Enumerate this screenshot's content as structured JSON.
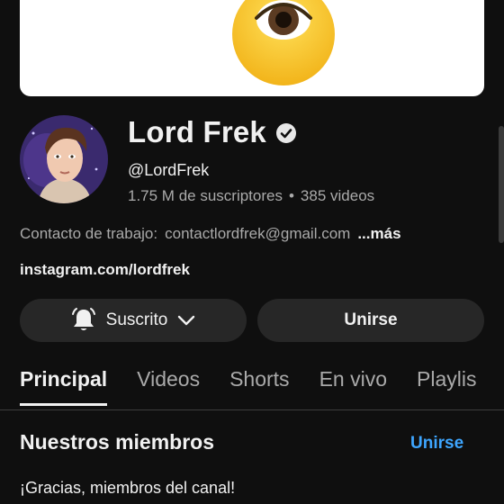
{
  "channel": {
    "name": "Lord Frek",
    "handle": "@LordFrek",
    "subscribers": "1.75 M de suscriptores",
    "separator": "•",
    "videos": "385 videos",
    "description_label": "Contacto de trabajo:",
    "description_email": "contactlordfrek@gmail.com",
    "more_label": "...más",
    "link": "instagram.com/lordfrek"
  },
  "actions": {
    "subscribed_label": "Suscrito",
    "join_label": "Unirse"
  },
  "tabs": [
    {
      "label": "Principal",
      "active": true
    },
    {
      "label": "Videos"
    },
    {
      "label": "Shorts"
    },
    {
      "label": "En vivo"
    },
    {
      "label": "Playlis"
    }
  ],
  "section": {
    "title": "Nuestros miembros",
    "action": "Unirse",
    "subtitle": "¡Gracias, miembros del canal!"
  },
  "colors": {
    "background": "#0f0f0f",
    "button": "#272727",
    "link_blue": "#3ea6ff",
    "emoji_yellow": "#f7c526"
  },
  "icons": [
    "eye-emoji-icon",
    "verified-check-icon",
    "bell-icon",
    "chevron-down-icon"
  ]
}
